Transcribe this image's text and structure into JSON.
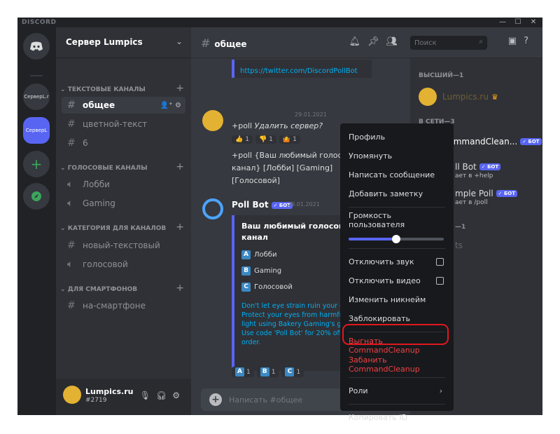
{
  "app": {
    "brand": "DISCORD"
  },
  "window": {
    "minimize": "—",
    "maximize": "☐",
    "close": "✕"
  },
  "servers": [
    {
      "label": "СервepL.r"
    },
    {
      "label": "СервepL"
    }
  ],
  "sidebar": {
    "server_name": "Сервер Lumpics",
    "categories": [
      {
        "label": "ТЕКСТОВЫЕ КАНАЛЫ"
      },
      {
        "label": "ГОЛОСОВЫЕ КАНАЛЫ"
      },
      {
        "label": "КАТЕГОРИЯ ДЛЯ КАНАЛОВ"
      },
      {
        "label": "ДЛЯ СМАРТФОНОВ"
      }
    ],
    "channels": [
      {
        "name": "общее"
      },
      {
        "name": "цветной-текст"
      },
      {
        "name": "6"
      },
      {
        "name": "Лобби"
      },
      {
        "name": "Gaming"
      },
      {
        "name": "новый-текстовый"
      },
      {
        "name": "голосовой"
      },
      {
        "name": "на-смартфоне"
      }
    ],
    "user": {
      "name": "Lumpics.ru",
      "tag": "#2719"
    }
  },
  "chat": {
    "channel": "общее",
    "link": "https://twitter.com/DiscordPollBot",
    "msg1": {
      "date": "29.01.2021",
      "line1_prefix": "+poll ",
      "line1_italic": "Удалить сервер?",
      "reactions": [
        "1",
        "1",
        "1"
      ],
      "line2": "+poll {Ваш любимый голосо",
      "line3": "канал} [Лобби] [Gaming]",
      "line4": "[Голосовой]"
    },
    "bot": {
      "name": "Poll Bot",
      "badge": "✓ БОТ",
      "date": "29.01.2021",
      "question": "Ваш любимый голосовой канал",
      "options": [
        {
          "letter": "A",
          "label": "Лобби"
        },
        {
          "letter": "B",
          "label": "Gaming"
        },
        {
          "letter": "C",
          "label": "Голосовой"
        }
      ],
      "ad": "Don't let eye strain ruin your day. Protect your eyes from harmful blue light using Bakery Gaming's glasses. Use code 'Poll Bot' for 20% off your order.",
      "reactions": [
        {
          "letter": "A",
          "count": "1"
        },
        {
          "letter": "B",
          "count": "1"
        },
        {
          "letter": "C",
          "count": "1"
        }
      ]
    },
    "composer_placeholder": "Написать #общее"
  },
  "members": {
    "search_placeholder": "Поиск",
    "role1": "ВЫСШИЙ—1",
    "role1_member": "Lumpics.ru",
    "role2": "В СЕТИ—3",
    "m1": "CommandClean...",
    "m1_badge": "✓ БОТ",
    "m2": "ll Bot",
    "m2_badge": "✓ БОТ",
    "m2_sub": "ает в +help",
    "m3": "mple Poll",
    "m3_badge": "✓ БОТ",
    "m3_sub": "ает в /poll",
    "role3": "—1",
    "m4": "ts"
  },
  "context_menu": {
    "profile": "Профиль",
    "mention": "Упомянуть",
    "message": "Написать сообщение",
    "note": "Добавить заметку",
    "volume": "Громкость пользователя",
    "volume_percent": 50,
    "mute": "Отключить звук",
    "disable_video": "Отключить видео",
    "nickname": "Изменить никнейм",
    "block": "Заблокировать",
    "kick": "Выгнать CommandCleanup",
    "ban": "Забанить CommandCleanup",
    "roles": "Роли",
    "copy_id": "Копировать ID"
  },
  "colors": {
    "accent": "#5865f2",
    "danger": "#ed4245",
    "highlight": "#e0181f"
  }
}
